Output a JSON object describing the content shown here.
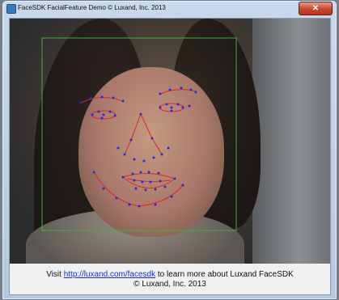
{
  "window": {
    "title": "FaceSDK FacialFeature Demo © Luxand, Inc. 2013",
    "close_label": "✕"
  },
  "footer": {
    "visit_prefix": "Visit",
    "link_text": "http://luxand.com/facesdk",
    "visit_suffix": "to learn more about Luxand FaceSDK",
    "copyright": "© Luxand, Inc. 2013"
  },
  "colors": {
    "face_box": "#3fae3f",
    "feature_points": "#2a2ad8",
    "feature_lines": "#e0262a"
  }
}
